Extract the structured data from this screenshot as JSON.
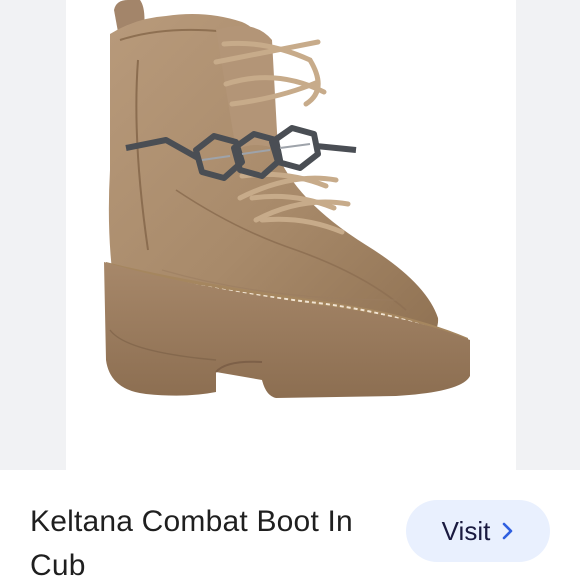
{
  "product": {
    "title": "Keltana Combat Boot In Cub",
    "image_alt": "boot-product-photo"
  },
  "actions": {
    "visit_label": "Visit",
    "visit_icon": "chevron-right-icon"
  },
  "colors": {
    "boot": "#a98b6c",
    "sole": "#9a7a5c",
    "chain": "#4a4e54",
    "button_bg": "#e9f0fe",
    "button_text": "#1a1a40"
  }
}
